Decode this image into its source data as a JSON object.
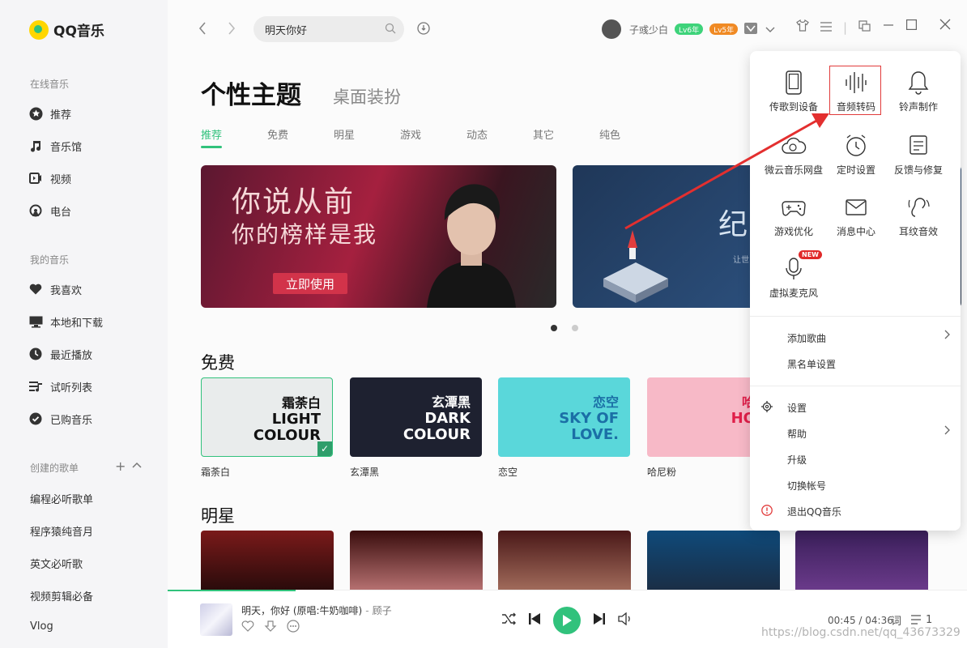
{
  "app": {
    "name": "QQ音乐"
  },
  "sidebar": {
    "online_heading": "在线音乐",
    "online_items": [
      {
        "label": "推荐",
        "icon": "star-circle-icon"
      },
      {
        "label": "音乐馆",
        "icon": "music-note-icon"
      },
      {
        "label": "视频",
        "icon": "video-icon"
      },
      {
        "label": "电台",
        "icon": "radio-icon"
      }
    ],
    "my_heading": "我的音乐",
    "my_items": [
      {
        "label": "我喜欢",
        "icon": "heart-icon"
      },
      {
        "label": "本地和下载",
        "icon": "monitor-icon"
      },
      {
        "label": "最近播放",
        "icon": "clock-icon"
      },
      {
        "label": "试听列表",
        "icon": "playlist-icon"
      },
      {
        "label": "已购音乐",
        "icon": "check-circle-icon"
      }
    ],
    "created_heading": "创建的歌单",
    "playlists": [
      "编程必听歌单",
      "程序猿纯音月",
      "英文必听歌",
      "视频剪辑必备",
      "Vlog"
    ]
  },
  "topbar": {
    "search_value": "明天你好",
    "username": "子彧少白",
    "badge_green": "Lv6年",
    "badge_orange": "Lv5年"
  },
  "main": {
    "title": "个性主题",
    "subtitle": "桌面装扮",
    "tabs": [
      "推荐",
      "免费",
      "明星",
      "游戏",
      "动态",
      "其它",
      "纯色"
    ],
    "banner1": {
      "line1": "你说从前",
      "line2": "你的榜样是我",
      "button": "立即使用"
    },
    "banner2": {
      "text": "纪",
      "sub": "让世"
    },
    "free_section": "免费",
    "themes": [
      {
        "label": "霜荼白",
        "cn": "霜荼白",
        "en": "LIGHT COLOUR",
        "bg": "#e9ecec",
        "fg": "#111111"
      },
      {
        "label": "玄潭黑",
        "cn": "玄潭黑",
        "en": "DARK COLOUR",
        "bg": "#1e2130",
        "fg": "#ffffff"
      },
      {
        "label": "恋空",
        "cn": "恋空",
        "en": "SKY OF LOVE.",
        "bg": "#5ad7da",
        "fg": "#1b6fa6"
      },
      {
        "label": "哈尼粉",
        "cn": "哈尼",
        "en": "HON PI",
        "bg": "#f7b9c7",
        "fg": "#e01f4a"
      }
    ],
    "stars_section": "明星"
  },
  "player": {
    "song_title": "明天，你好 (原唱:牛奶咖啡)",
    "separator": "-",
    "artist": "顾子",
    "time": "00:45 / 04:36",
    "lyrics_label": "词",
    "queue_count": "1",
    "progress": 0.16,
    "watermark": "https://blog.csdn.net/qq_43673329"
  },
  "menu": {
    "grid": [
      {
        "label": "传歌到设备",
        "icon": "phone-icon"
      },
      {
        "label": "音频转码",
        "icon": "audio-wave-icon"
      },
      {
        "label": "铃声制作",
        "icon": "bell-icon"
      },
      {
        "label": "微云音乐网盘",
        "icon": "cloud-icon"
      },
      {
        "label": "定时设置",
        "icon": "alarm-icon"
      },
      {
        "label": "反馈与修复",
        "icon": "feedback-icon"
      },
      {
        "label": "游戏优化",
        "icon": "gamepad-icon"
      },
      {
        "label": "消息中心",
        "icon": "mail-icon"
      },
      {
        "label": "耳纹音效",
        "icon": "ear-icon"
      },
      {
        "label": "虚拟麦克风",
        "icon": "microphone-icon"
      }
    ],
    "new_badge": "NEW",
    "list1": [
      "添加歌曲",
      "黑名单设置"
    ],
    "list2": [
      "设置",
      "帮助",
      "升级",
      "切换帐号",
      "退出QQ音乐"
    ]
  }
}
